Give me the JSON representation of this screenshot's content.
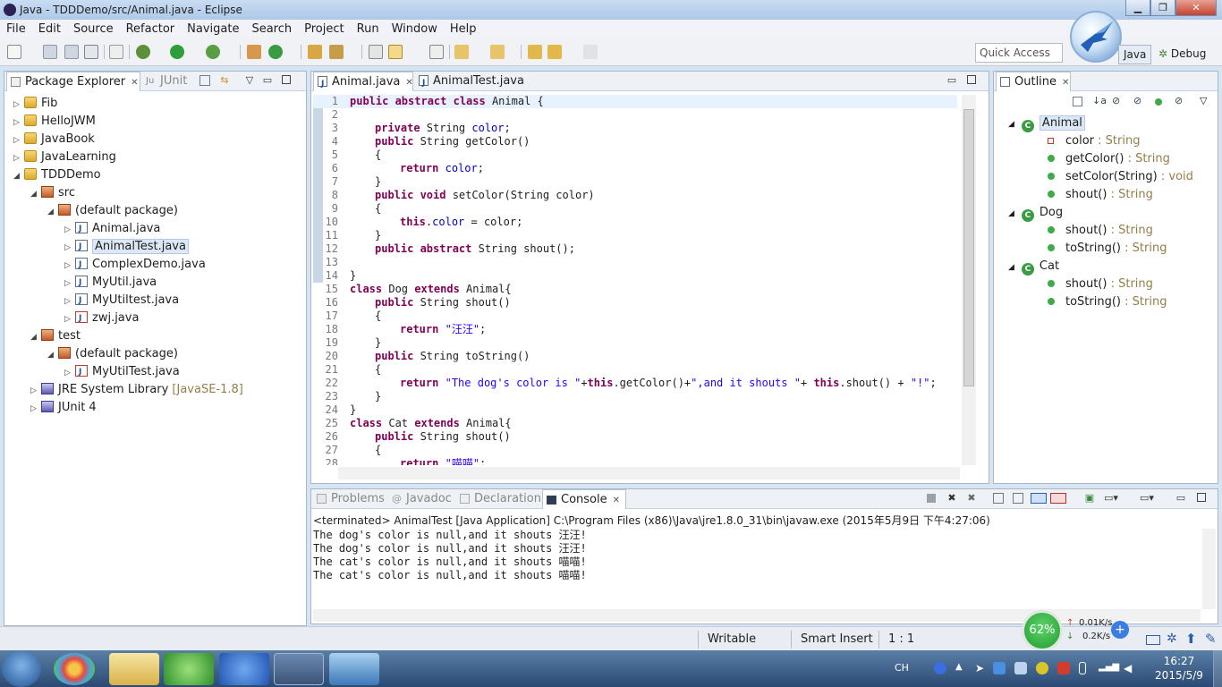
{
  "window": {
    "title": "Java - TDDDemo/src/Animal.java - Eclipse"
  },
  "menu": [
    "File",
    "Edit",
    "Source",
    "Refactor",
    "Navigate",
    "Search",
    "Project",
    "Run",
    "Window",
    "Help"
  ],
  "quick_access": "Quick Access",
  "perspectives": {
    "java": "Java",
    "debug": "Debug"
  },
  "package_explorer": {
    "tabs": [
      "Package Explorer",
      "JUnit"
    ],
    "items": [
      {
        "label": "Fib",
        "extra": ""
      },
      {
        "label": "HelloJWM",
        "extra": ""
      },
      {
        "label": "JavaBook",
        "extra": ""
      },
      {
        "label": "JavaLearning",
        "extra": ""
      },
      {
        "label": "TDDDemo",
        "extra": ""
      },
      {
        "label": "src",
        "extra": ""
      },
      {
        "label": "(default package)",
        "extra": ""
      },
      {
        "label": "Animal.java",
        "extra": ""
      },
      {
        "label": "AnimalTest.java",
        "extra": ""
      },
      {
        "label": "ComplexDemo.java",
        "extra": ""
      },
      {
        "label": "MyUtil.java",
        "extra": ""
      },
      {
        "label": "MyUtiltest.java",
        "extra": ""
      },
      {
        "label": "zwj.java",
        "extra": ""
      },
      {
        "label": "test",
        "extra": ""
      },
      {
        "label": "(default package)",
        "extra": ""
      },
      {
        "label": "MyUtilTest.java",
        "extra": ""
      },
      {
        "label": "JRE System Library",
        "extra": "[JavaSE-1.8]"
      },
      {
        "label": "JUnit 4",
        "extra": ""
      }
    ]
  },
  "editor": {
    "tabs": [
      "Animal.java",
      "AnimalTest.java"
    ],
    "lines": [
      "1",
      "2",
      "3",
      "4",
      "5",
      "6",
      "7",
      "8",
      "9",
      "10",
      "11",
      "12",
      "13",
      "14",
      "15",
      "16",
      "17",
      "18",
      "19",
      "20",
      "21",
      "22",
      "23",
      "24",
      "25",
      "26",
      "27",
      "28"
    ],
    "code": {
      "l1a": "public abstract class",
      "l1b": " Animal {",
      "l3a": "private",
      "l3b": " String ",
      "l3c": "color",
      "l3d": ";",
      "l4a": "public",
      "l4b": " String getColor()",
      "l5": "{",
      "l6a": "return",
      "l6b": " ",
      "l6c": "color",
      "l6d": ";",
      "l7": "}",
      "l8a": "public void",
      "l8b": " setColor(String color)",
      "l9": "{",
      "l10a": "this",
      "l10b": ".",
      "l10c": "color",
      "l10d": " = color;",
      "l11": "}",
      "l12a": "public abstract",
      "l12b": " String shout();",
      "l14": "}",
      "l15a": "class",
      "l15b": " Dog ",
      "l15c": "extends",
      "l15d": " Animal{",
      "l16a": "public",
      "l16b": " String shout()",
      "l17": "{",
      "l18a": "return",
      "l18b": " ",
      "l18c": "\"汪汪\"",
      "l18d": ";",
      "l19": "}",
      "l20a": "public",
      "l20b": " String toString()",
      "l21": "{",
      "l22a": "return",
      "l22b": " ",
      "l22c": "\"The dog's color is \"",
      "l22d": "+",
      "l22e": "this",
      "l22f": ".getColor()+",
      "l22g": "\",and it shouts \"",
      "l22h": "+ ",
      "l22i": "this",
      "l22j": ".shout() + ",
      "l22k": "\"!\"",
      "l22l": ";",
      "l23": "}",
      "l24": "}",
      "l25a": "class",
      "l25b": " Cat ",
      "l25c": "extends",
      "l25d": " Animal{",
      "l26a": "public",
      "l26b": " String shout()",
      "l27": "{",
      "l28a": "return",
      "l28b": " ",
      "l28c": "\"喵喵\"",
      "l28d": ";"
    }
  },
  "outline": {
    "title": "Outline",
    "items": [
      {
        "name": "Animal",
        "type": ""
      },
      {
        "name": "color",
        "type": " : String"
      },
      {
        "name": "getColor()",
        "type": " : String"
      },
      {
        "name": "setColor(String)",
        "type": " : void"
      },
      {
        "name": "shout()",
        "type": " : String"
      },
      {
        "name": "Dog",
        "type": ""
      },
      {
        "name": "shout()",
        "type": " : String"
      },
      {
        "name": "toString()",
        "type": " : String"
      },
      {
        "name": "Cat",
        "type": ""
      },
      {
        "name": "shout()",
        "type": " : String"
      },
      {
        "name": "toString()",
        "type": " : String"
      }
    ]
  },
  "bottom": {
    "tabs": [
      "Problems",
      "Javadoc",
      "Declaration",
      "Console"
    ],
    "terminated": "<terminated> AnimalTest [Java Application] C:\\Program Files (x86)\\Java\\jre1.8.0_31\\bin\\javaw.exe (2015年5月9日 下午4:27:06)",
    "output": [
      "The dog's color is null,and it shouts 汪汪!",
      "The dog's color is null,and it shouts 汪汪!",
      "The cat's color is null,and it shouts 喵喵!",
      "The cat's color is null,and it shouts 喵喵!"
    ]
  },
  "status": {
    "writable": "Writable",
    "insert": "Smart Insert",
    "pos": "1 : 1"
  },
  "network": {
    "percent": "62%",
    "up": "0.01K/s",
    "down": "0.2K/s"
  },
  "tray": {
    "lang": "CH",
    "time": "16:27",
    "date": "2015/5/9"
  }
}
